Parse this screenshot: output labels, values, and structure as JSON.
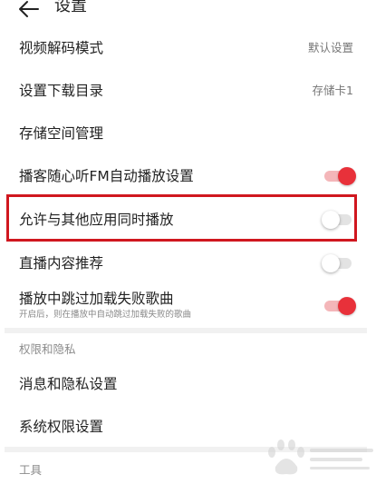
{
  "header": {
    "title": "设置",
    "back_icon": "back-arrow-icon"
  },
  "rows": [
    {
      "label": "视频解码模式",
      "value": "默认设置"
    },
    {
      "label": "设置下载目录",
      "value": "存储卡1"
    },
    {
      "label": "存储空间管理"
    },
    {
      "label": "播客随心听FM自动播放设置",
      "toggle": "on"
    },
    {
      "label": "允许与其他应用同时播放",
      "toggle": "off"
    },
    {
      "label": "直播内容推荐",
      "toggle": "off"
    },
    {
      "label": "播放中跳过加载失败歌曲",
      "sub": "开启后，则在播放中自动跳过加载失败的歌曲",
      "toggle": "on"
    }
  ],
  "sections": {
    "privacy": {
      "title": "权限和隐私",
      "items": [
        "消息和隐私设置",
        "系统权限设置"
      ]
    },
    "tools": {
      "title": "工具"
    }
  },
  "colors": {
    "accent": "#e8313a",
    "highlight_border": "#d0171f",
    "divider": "#f1f1f1"
  },
  "watermark": {
    "icon": "baidu-jingyan-paw-watermark"
  }
}
